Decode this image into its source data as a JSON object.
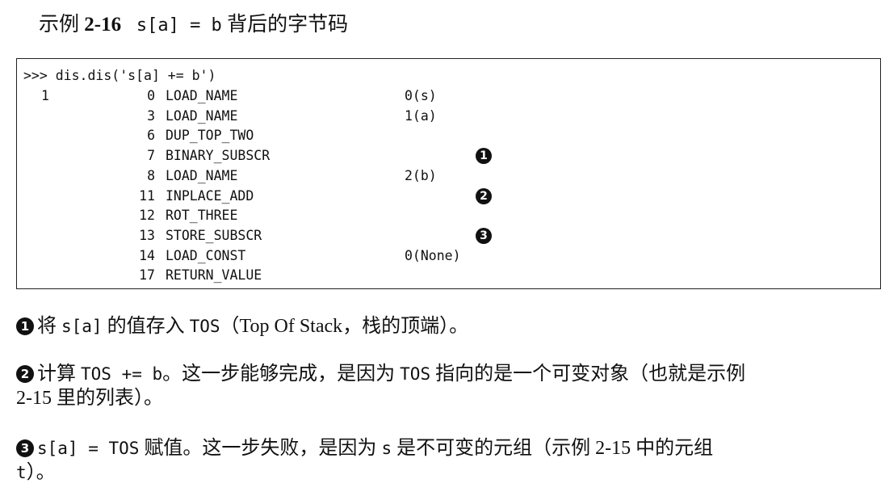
{
  "title": {
    "prefix": "示例 ",
    "number": "2-16",
    "code": "s[a] = b",
    "suffix": " 背后的字节码"
  },
  "code": {
    "command": ">>> dis.dis('s[a] += b')",
    "rows": [
      {
        "line": "1",
        "offset": "0",
        "op": "LOAD_NAME",
        "arg": "0(s)",
        "callout": ""
      },
      {
        "line": "",
        "offset": "3",
        "op": "LOAD_NAME",
        "arg": "1(a)",
        "callout": ""
      },
      {
        "line": "",
        "offset": "6",
        "op": "DUP_TOP_TWO",
        "arg": "",
        "callout": ""
      },
      {
        "line": "",
        "offset": "7",
        "op": "BINARY_SUBSCR",
        "arg": "",
        "callout": "1"
      },
      {
        "line": "",
        "offset": "8",
        "op": "LOAD_NAME",
        "arg": "2(b)",
        "callout": ""
      },
      {
        "line": "",
        "offset": "11",
        "op": "INPLACE_ADD",
        "arg": "",
        "callout": "2"
      },
      {
        "line": "",
        "offset": "12",
        "op": "ROT_THREE",
        "arg": "",
        "callout": ""
      },
      {
        "line": "",
        "offset": "13",
        "op": "STORE_SUBSCR",
        "arg": "",
        "callout": "3"
      },
      {
        "line": "",
        "offset": "14",
        "op": "LOAD_CONST",
        "arg": "0(None)",
        "callout": ""
      },
      {
        "line": "",
        "offset": "17",
        "op": "RETURN_VALUE",
        "arg": "",
        "callout": ""
      }
    ]
  },
  "notes": [
    {
      "bullet": "1",
      "lines": [
        [
          {
            "t": "将 "
          },
          {
            "t": "s[a]",
            "m": true
          },
          {
            "t": " 的值存入 "
          },
          {
            "t": "TOS",
            "m": true
          },
          {
            "t": "（Top Of Stack，栈的顶端）。"
          }
        ]
      ]
    },
    {
      "bullet": "2",
      "lines": [
        [
          {
            "t": "计算 "
          },
          {
            "t": "TOS += b",
            "m": true
          },
          {
            "t": "。这一步能够完成，是因为 "
          },
          {
            "t": "TOS",
            "m": true
          },
          {
            "t": " 指向的是一个可变对象（也就是示例"
          }
        ],
        [
          {
            "t": "2-15 里的列表）。"
          }
        ]
      ]
    },
    {
      "bullet": "3",
      "lines": [
        [
          {
            "t": "s[a] = TOS",
            "m": true
          },
          {
            "t": " 赋值。这一步失败，是因为 "
          },
          {
            "t": "s",
            "m": true
          },
          {
            "t": " 是不可变的元组（示例 2-15 中的元组"
          }
        ],
        [
          {
            "t": "t",
            "m": true
          },
          {
            "t": "）。"
          }
        ]
      ]
    }
  ]
}
